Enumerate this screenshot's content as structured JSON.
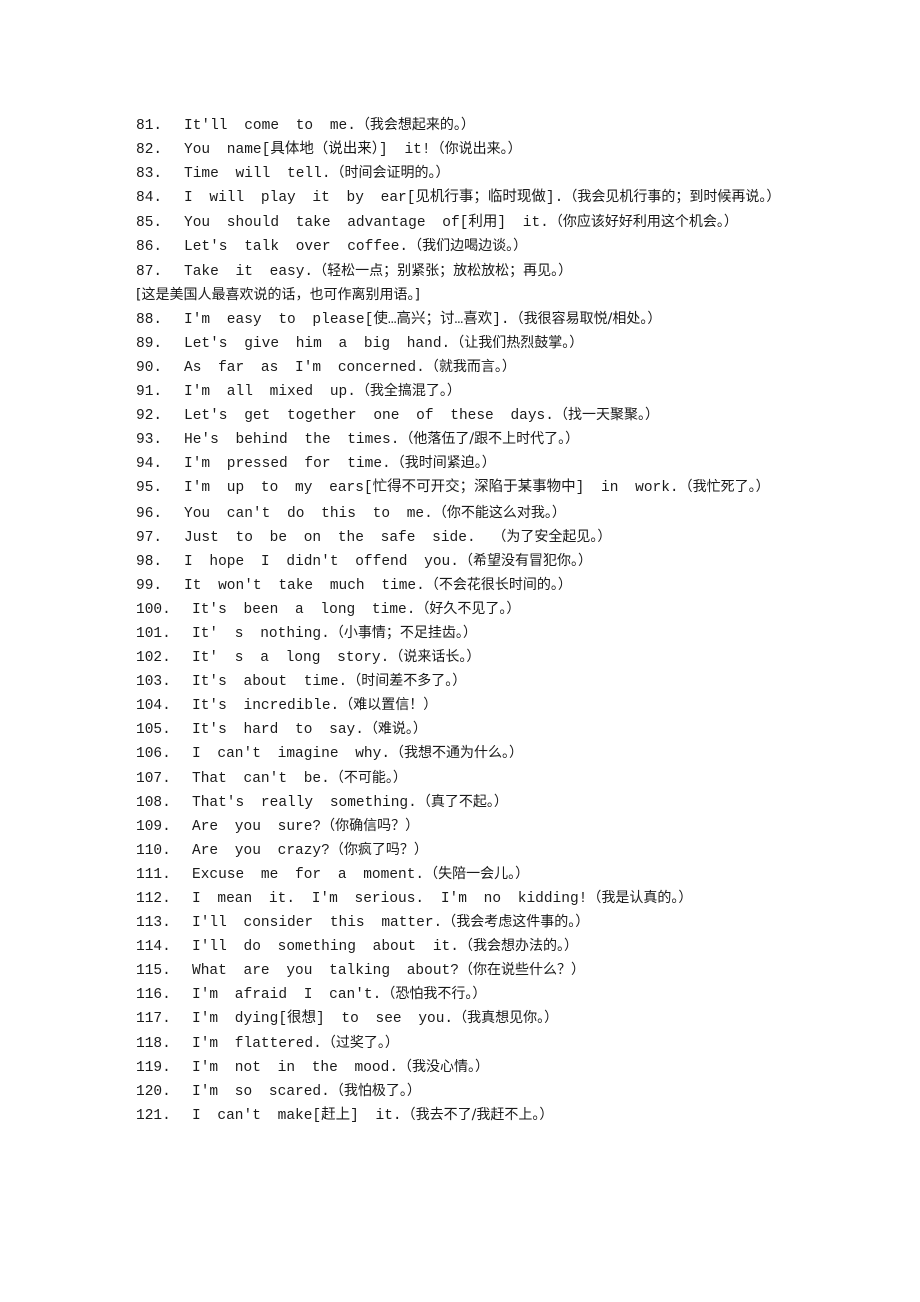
{
  "document": {
    "entries": [
      {
        "num": "81.",
        "en": "It'll come to me.",
        "zh": "（我会想起来的。）"
      },
      {
        "num": "82.",
        "en": "You name[具体地（说出来）] it!",
        "zh": "（你说出来。）"
      },
      {
        "num": "83.",
        "en": "Time will tell.",
        "zh": "（时间会证明的。）"
      },
      {
        "num": "84.",
        "en": "I will play it by ear[见机行事；临时现做].",
        "zh": "（我会见机行事的；到时候再说。）"
      },
      {
        "num": "85.",
        "en": "You should take advantage of[利用] it.",
        "zh": "（你应该好好利用这个机会。）"
      },
      {
        "num": "86.",
        "en": "Let's talk over coffee.",
        "zh": "（我们边喝边谈。）"
      },
      {
        "num": "87.",
        "en": "Take it easy.",
        "zh": "（轻松一点；别紧张；放松放松；再见。）",
        "note": "[这是美国人最喜欢说的话，也可作离别用语。]"
      },
      {
        "num": "88.",
        "en": "I'm easy to please[使…高兴；讨…喜欢].",
        "zh": "（我很容易取悦/相处。）"
      },
      {
        "num": "89.",
        "en": "Let's give him a big hand.",
        "zh": "（让我们热烈鼓掌。）"
      },
      {
        "num": "90.",
        "en": "As far as I'm concerned.",
        "zh": "（就我而言。）"
      },
      {
        "num": "91.",
        "en": "I'm all mixed up.",
        "zh": "（我全搞混了。）"
      },
      {
        "num": "92.",
        "en": "Let's get together one of these days.",
        "zh": "（找一天聚聚。）"
      },
      {
        "num": "93.",
        "en": "He's behind the times.",
        "zh": "（他落伍了/跟不上时代了。）"
      },
      {
        "num": "94.",
        "en": "I'm pressed for time.",
        "zh": "（我时间紧迫。）"
      },
      {
        "num": "95.",
        "en": "I'm up to my ears[忙得不可开交；深陷于某事物中] in work.",
        "zh": "（我忙死了。）"
      },
      {
        "num": "96.",
        "en": "You can't do this to me.",
        "zh": "（你不能这么对我。）"
      },
      {
        "num": "97.",
        "en": "Just to be on the safe side. ",
        "zh": "（为了安全起见。）"
      },
      {
        "num": "98.",
        "en": "I hope I didn't offend you.",
        "zh": "（希望没有冒犯你。）"
      },
      {
        "num": "99.",
        "en": "It won't take much time.",
        "zh": "（不会花很长时间的。）"
      },
      {
        "num": "100.",
        "en": "It's been a long time.",
        "zh": "（好久不见了。）"
      },
      {
        "num": "101.",
        "en": "It' s nothing.",
        "zh": "（小事情；不足挂齿。）"
      },
      {
        "num": "102.",
        "en": "It' s a long story.",
        "zh": "（说来话长。）"
      },
      {
        "num": "103.",
        "en": "It's about time.",
        "zh": "（时间差不多了。）"
      },
      {
        "num": "104.",
        "en": "It's incredible.",
        "zh": "（难以置信！）"
      },
      {
        "num": "105.",
        "en": "It's hard to say.",
        "zh": "（难说。）"
      },
      {
        "num": "106.",
        "en": "I can't imagine why.",
        "zh": "（我想不通为什么。）"
      },
      {
        "num": "107.",
        "en": "That can't be.",
        "zh": "（不可能。）"
      },
      {
        "num": "108.",
        "en": "That's really something.",
        "zh": "（真了不起。）"
      },
      {
        "num": "109.",
        "en": "Are you sure?",
        "zh": "（你确信吗？）"
      },
      {
        "num": "110.",
        "en": "Are you crazy?",
        "zh": "（你疯了吗？）"
      },
      {
        "num": "111.",
        "en": "Excuse me for a moment.",
        "zh": "（失陪一会儿。）"
      },
      {
        "num": "112.",
        "en": "I mean it. I'm serious. I'm no kidding!",
        "zh": "（我是认真的。）"
      },
      {
        "num": "113.",
        "en": "I'll consider this matter.",
        "zh": "（我会考虑这件事的。）"
      },
      {
        "num": "114.",
        "en": "I'll do something about it.",
        "zh": "（我会想办法的。）"
      },
      {
        "num": "115.",
        "en": "What are you talking about?",
        "zh": "（你在说些什么？）"
      },
      {
        "num": "116.",
        "en": "I'm afraid I can't.",
        "zh": "（恐怕我不行。）"
      },
      {
        "num": "117.",
        "en": "I'm dying[很想] to see you.",
        "zh": "（我真想见你。）"
      },
      {
        "num": "118.",
        "en": "I'm flattered.",
        "zh": "（过奖了。）"
      },
      {
        "num": "119.",
        "en": "I'm not in the mood.",
        "zh": "（我没心情。）"
      },
      {
        "num": "120.",
        "en": "I'm so scared.",
        "zh": "（我怕极了。）"
      },
      {
        "num": "121.",
        "en": "I can't make[赶上] it.",
        "zh": "（我去不了/我赶不上。）"
      }
    ]
  }
}
